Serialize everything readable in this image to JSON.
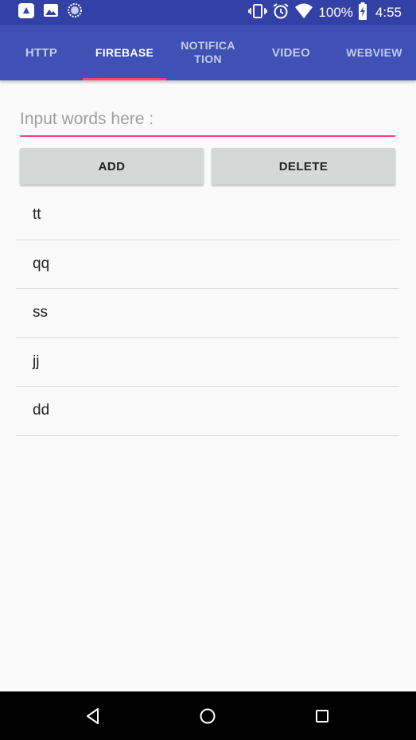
{
  "status_bar": {
    "battery_percent": "100%",
    "time": "4:55",
    "left_icons": [
      "app-notification-icon",
      "image-notification-icon",
      "sync-notification-icon"
    ],
    "right_icons": [
      "vibrate-icon",
      "alarm-icon",
      "wifi-icon",
      "battery-charging-icon"
    ]
  },
  "tabs": [
    {
      "label": "HTTP",
      "active": false
    },
    {
      "label": "FIREBASE",
      "active": true
    },
    {
      "label": "NOTIFICATION",
      "active": false
    },
    {
      "label": "VIDEO",
      "active": false
    },
    {
      "label": "WEBVIEW",
      "active": false
    }
  ],
  "input": {
    "placeholder": "Input words here :",
    "value": ""
  },
  "buttons": {
    "add_label": "ADD",
    "delete_label": "DELETE"
  },
  "list": {
    "items": [
      "tt",
      "qq",
      "ss",
      "jj",
      "dd"
    ]
  },
  "colors": {
    "primary": "#3f51b5",
    "primary_dark": "#3341a6",
    "accent": "#ff4081",
    "background": "#fafafa",
    "button": "#d6d7d7"
  },
  "nav_bar": {
    "icons": [
      "back-icon",
      "home-icon",
      "recents-icon"
    ]
  }
}
